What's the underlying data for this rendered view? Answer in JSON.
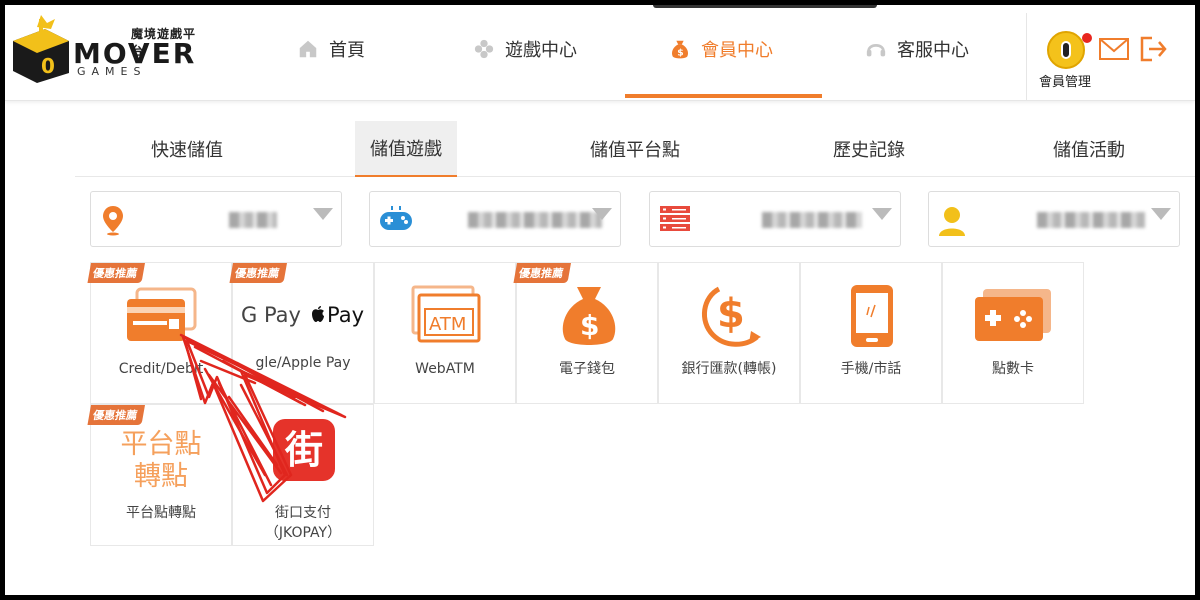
{
  "logo": {
    "cn": "魔境遊戲平台",
    "en": "MOVER",
    "sub": "GAMES"
  },
  "nav": [
    {
      "label": "首頁",
      "icon": "home-icon"
    },
    {
      "label": "遊戲中心",
      "icon": "gamepad-icon"
    },
    {
      "label": "會員中心",
      "icon": "money-bag-icon",
      "active": true
    },
    {
      "label": "客服中心",
      "icon": "headset-icon"
    }
  ],
  "user": {
    "member_label": "會員管理"
  },
  "tabs": [
    {
      "label": "快速儲值"
    },
    {
      "label": "儲值遊戲",
      "active": true
    },
    {
      "label": "儲值平台點"
    },
    {
      "label": "歷史記錄"
    },
    {
      "label": "儲值活動"
    }
  ],
  "selects": [
    {
      "icon": "location-icon"
    },
    {
      "icon": "gamepad-icon"
    },
    {
      "icon": "server-icon"
    },
    {
      "icon": "user-icon"
    }
  ],
  "payments": [
    {
      "label": "Credit/Debit",
      "icon": "credit-card-icon",
      "ribbon": "優惠推薦"
    },
    {
      "label": "gle/Apple Pay",
      "brand_g": "G Pay",
      "brand_a": "Pay",
      "icon": "google-apple-pay-icon",
      "ribbon": "優惠推薦"
    },
    {
      "label": "WebATM",
      "icon": "atm-icon",
      "icon_text": "ATM"
    },
    {
      "label": "電子錢包",
      "icon": "money-bag-icon",
      "ribbon": "優惠推薦"
    },
    {
      "label": "銀行匯款(轉帳)",
      "icon": "bank-transfer-icon"
    },
    {
      "label": "手機/市話",
      "icon": "mobile-phone-icon"
    },
    {
      "label": "點數卡",
      "icon": "game-card-icon"
    },
    {
      "label": "平台點轉點",
      "icon_line1": "平台點",
      "icon_line2": "轉點",
      "ribbon": "優惠推薦"
    },
    {
      "label_line1": "街口支付",
      "label_line2": "（JKOPAY）",
      "icon": "jkopay-icon",
      "icon_text": "街"
    }
  ],
  "colors": {
    "accent": "#f07d2c",
    "ribbon": "#e5743a",
    "annotation": "#e0261e"
  }
}
